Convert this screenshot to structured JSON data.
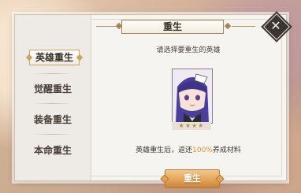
{
  "dialog": {
    "title": "重生",
    "prompt": "请选择要重生的英雄",
    "result_prefix": "英雄重生后，返还",
    "result_percent": "100%",
    "result_suffix": "养成材料",
    "action_label": "重生",
    "close_glyph": "✕"
  },
  "sidebar": {
    "items": [
      {
        "label": "英雄重生",
        "active": true
      },
      {
        "label": "觉醒重生",
        "active": false
      },
      {
        "label": "装备重生",
        "active": false
      },
      {
        "label": "本命重生",
        "active": false
      }
    ]
  },
  "hero": {
    "stars": "★★★★",
    "star_count": 4
  },
  "colors": {
    "accent_gold": "#c9a46a",
    "button_orange": "#e3a45a",
    "percent_highlight": "#d6912d",
    "close_dark": "#3a3532"
  },
  "icons": {
    "close": "close-icon",
    "hero_portrait": "hero-portrait"
  }
}
